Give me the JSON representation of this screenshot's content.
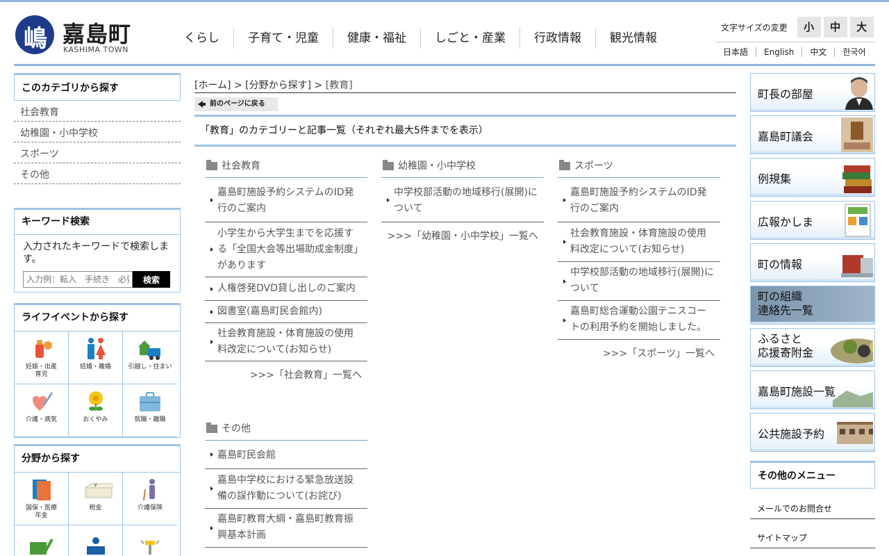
{
  "header": {
    "logo_char": "嶋",
    "logo_name": "嘉島町",
    "logo_sub": "KASHIMA TOWN",
    "nav": [
      "くらし",
      "子育て・児童",
      "健康・福祉",
      "しごと・産業",
      "行政情報",
      "観光情報"
    ],
    "font_size_label": "文字サイズの変更",
    "font_sizes": [
      "小",
      "中",
      "大"
    ],
    "languages": [
      "日本語",
      "English",
      "中文",
      "한국어"
    ]
  },
  "left": {
    "category_title": "このカテゴリから探す",
    "categories": [
      "社会教育",
      "幼稚園・小中学校",
      "スポーツ",
      "その他"
    ],
    "keyword": {
      "title": "キーワード検索",
      "description": "入力されたキーワードで検索します。",
      "placeholder": "入力例：転入　手続き　必要",
      "button": "検索"
    },
    "life_event": {
      "title": "ライフイベントから探す",
      "items": [
        {
          "label": "妊娠・出産\n育児",
          "icon": "baby-bottle-icon"
        },
        {
          "label": "結婚・離婚",
          "icon": "couple-icon"
        },
        {
          "label": "引越し・住まい",
          "icon": "house-truck-icon"
        },
        {
          "label": "介護・病気",
          "icon": "heart-syringe-icon"
        },
        {
          "label": "おくやみ",
          "icon": "chrysanthemum-icon"
        },
        {
          "label": "就職・離職",
          "icon": "briefcase-icon"
        }
      ]
    },
    "field": {
      "title": "分野から探す",
      "items": [
        {
          "label": "国保・医療\n年金",
          "icon": "insurance-card-icon"
        },
        {
          "label": "税金",
          "icon": "tax-bag-icon"
        },
        {
          "label": "介護保険",
          "icon": "elderly-cane-icon"
        },
        {
          "label": "",
          "icon": "book-pen-icon"
        },
        {
          "label": "",
          "icon": "counter-person-icon"
        },
        {
          "label": "",
          "icon": "speaker-icon"
        }
      ]
    }
  },
  "main": {
    "breadcrumb": {
      "home": "[ホーム]",
      "sep1": " > ",
      "field": "[分野から探す]",
      "sep2": " > ",
      "current": "[教育]"
    },
    "back_label": "前のページに戻る",
    "page_title": "「教育」のカテゴリーと記事一覧（それぞれ最大5件までを表示）",
    "columns": [
      {
        "heading": "社会教育",
        "items": [
          "嘉島町施設予約システムのID発行のご案内",
          "小学生から大学生までを応援する「全国大会等出場助成金制度」があります",
          "人権啓発DVD貸し出しのご案内",
          "図書室(嘉島町民会館内)",
          "社会教育施設・体育施設の使用料改定について(お知らせ)"
        ],
        "more": ">>>「社会教育」一覧へ"
      },
      {
        "heading": "幼稚園・小中学校",
        "items": [
          "中学校部活動の地域移行(展開)について"
        ],
        "more": ">>>「幼稚園・小中学校」一覧へ"
      },
      {
        "heading": "スポーツ",
        "items": [
          "嘉島町施設予約システムのID発行のご案内",
          "社会教育施設・体育施設の使用料改定について(お知らせ)",
          "中学校部活動の地域移行(展開)について",
          "嘉島町総合運動公園テニスコートの利用予約を開始しました。"
        ],
        "more": ">>>「スポーツ」一覧へ"
      },
      {
        "heading": "その他",
        "items": [
          "嘉島町民会館",
          "嘉島中学校における緊急放送設備の誤作動について(お詫び)",
          "嘉島町教育大綱・嘉島町教育振興基本計画"
        ],
        "more": ""
      }
    ]
  },
  "right": {
    "banners": [
      "町長の部屋",
      "嘉島町議会",
      "例規集",
      "広報かしま",
      "町の情報",
      "町の組織\n連絡先一覧",
      "ふるさと\n応援寄附金",
      "嘉島町施設一覧",
      "公共施設予約"
    ],
    "other_menu_title": "その他のメニュー",
    "other_menu": [
      "メールでのお問合せ",
      "サイトマップ"
    ]
  },
  "colors": {
    "accent": "#9dc3e6",
    "logo_blue": "#1f3b8c"
  }
}
